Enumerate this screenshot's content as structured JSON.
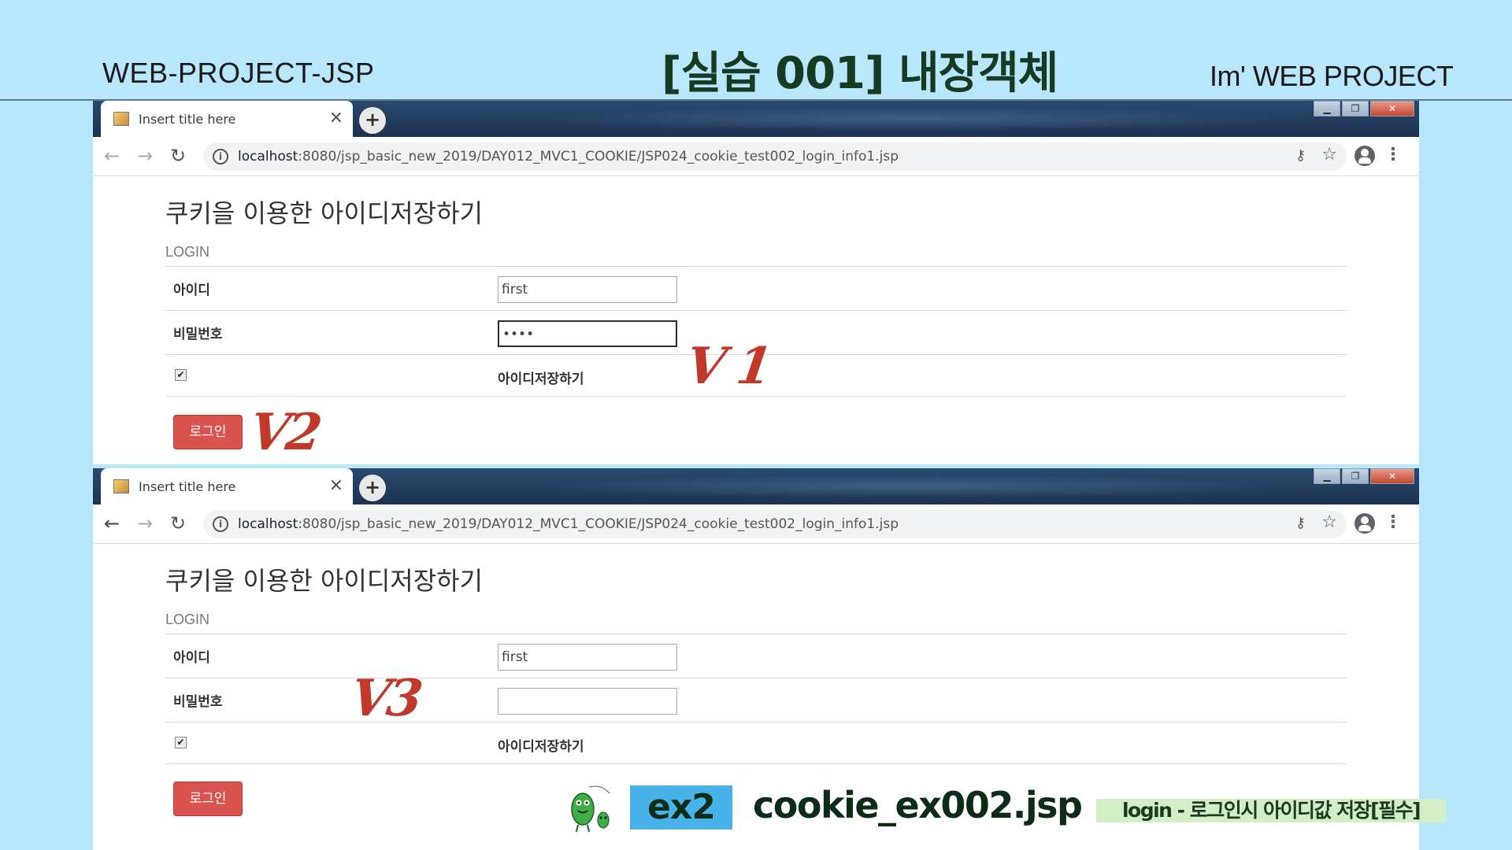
{
  "slide": {
    "left_label": "WEB-PROJECT-JSP",
    "title": "[실습 001]  내장객체",
    "right_label": "Im'  WEB PROJECT"
  },
  "browser": {
    "tab_title": "Insert title here",
    "tab_close": "×",
    "new_tab": "+",
    "url_host": "localhost",
    "url_rest": ":8080/jsp_basic_new_2019/DAY012_MVC1_COOKIE/JSP024_cookie_test002_login_info1.jsp",
    "window_buttons": [
      "▁",
      "❐",
      "✕"
    ]
  },
  "page": {
    "heading": "쿠키을 이용한 아이디저장하기",
    "login_label": "LOGIN",
    "id_label": "아이디",
    "pw_label": "비밀번호",
    "remember_label": "아이디저장하기",
    "login_button": "로그인"
  },
  "screen1": {
    "id_value": "first",
    "pw_value": "••••",
    "remember_checked": "✔"
  },
  "screen2": {
    "id_value": "first",
    "pw_value": "",
    "remember_checked": "✔"
  },
  "marks": {
    "v1": "V 1",
    "v2": "V2",
    "v3": "V3"
  },
  "footer": {
    "ex": "ex2",
    "file": "cookie_ex002.jsp",
    "note": "login - 로그인시 아이디값 저장[필수]"
  },
  "colors": {
    "slide_bg": "#b8e6fb",
    "accent_green": "#173a22",
    "login_button": "#d9534f",
    "check_mark": "#c0392b"
  }
}
